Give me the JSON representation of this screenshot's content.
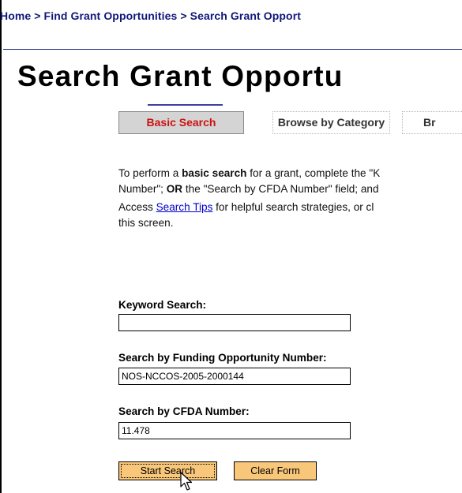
{
  "breadcrumb": "Home > Find Grant Opportunities > Search Grant Opport",
  "page_title": "Search Grant Opportu",
  "tabs": [
    {
      "label": "Basic Search",
      "active": true
    },
    {
      "label": "Browse by Category",
      "active": false
    },
    {
      "label": "Br",
      "active": false
    }
  ],
  "intro": {
    "line1_a": "To perform a ",
    "line1_b": "basic search",
    "line1_c": " for a grant, complete the \"K",
    "line2_a": "Number\"; ",
    "line2_b": "OR",
    "line2_c": " the \"Search by CFDA Number\" field; and"
  },
  "tips": {
    "line1_a": "Access ",
    "link": "Search Tips",
    "line1_b": " for helpful search strategies, or cl",
    "line2": "this screen."
  },
  "form": {
    "keyword": {
      "label": "Keyword Search:",
      "value": ""
    },
    "funding": {
      "label": "Search by Funding Opportunity Number:",
      "value": "NOS-NCCOS-2005-2000144"
    },
    "cfda": {
      "label": "Search by CFDA Number:",
      "value": "11.478"
    },
    "start_label": "Start Search",
    "clear_label": "Clear Form"
  },
  "colors": {
    "breadcrumb": "#11177a",
    "active_tab_text": "#cc1111",
    "button_bg": "#f9c77a",
    "link": "#0000cc"
  },
  "icons": [
    "mouse-pointer-icon"
  ]
}
